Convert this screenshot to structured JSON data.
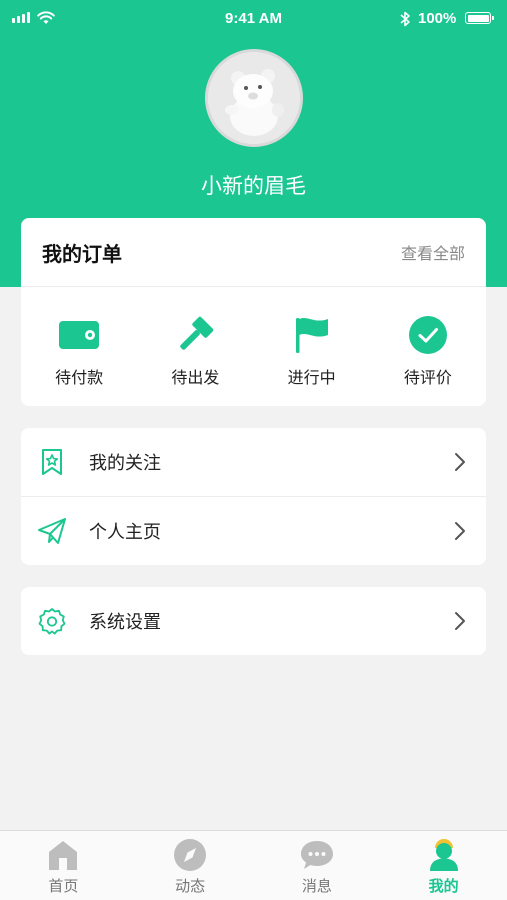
{
  "status_bar": {
    "time": "9:41 AM",
    "battery": "100%"
  },
  "profile": {
    "name": "小新的眉毛"
  },
  "orders": {
    "title": "我的订单",
    "view_all": "查看全部",
    "items": [
      {
        "label": "待付款",
        "icon": "wallet-icon"
      },
      {
        "label": "待出发",
        "icon": "gavel-icon"
      },
      {
        "label": "进行中",
        "icon": "flag-icon"
      },
      {
        "label": "待评价",
        "icon": "check-circle-icon"
      }
    ]
  },
  "menu": {
    "group1": [
      {
        "label": "我的关注",
        "icon": "bookmark-star-icon"
      },
      {
        "label": "个人主页",
        "icon": "paper-plane-icon"
      }
    ],
    "group2": [
      {
        "label": "系统设置",
        "icon": "gear-icon"
      }
    ]
  },
  "tabbar": {
    "tabs": [
      {
        "label": "首页",
        "icon": "home-icon"
      },
      {
        "label": "动态",
        "icon": "compass-icon"
      },
      {
        "label": "消息",
        "icon": "chat-icon"
      },
      {
        "label": "我的",
        "icon": "user-icon",
        "active": true
      }
    ]
  },
  "colors": {
    "accent": "#1cc691",
    "background": "#f2f2f2",
    "inactive_tab": "#bdbdbd"
  }
}
